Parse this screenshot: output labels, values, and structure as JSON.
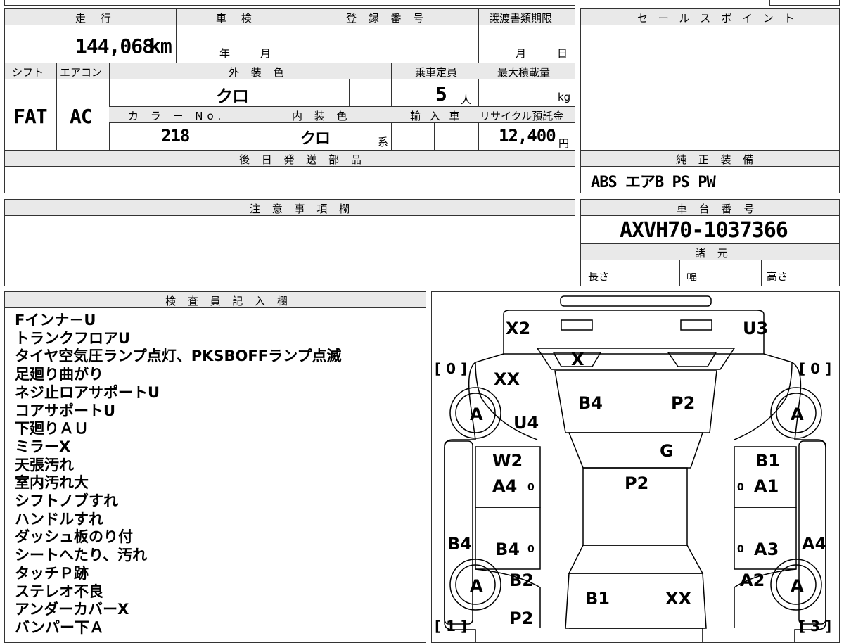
{
  "vehicle": {
    "mileage_label": "走 行",
    "mileage_value": "144,068",
    "mileage_unit": "km",
    "inspection_label": "車 検",
    "inspection_year": "年",
    "inspection_month": "月",
    "registration_label": "登 録 番 号",
    "transfer_deadline_label": "譲渡書類期限",
    "transfer_month": "月",
    "transfer_day": "日",
    "shift_label": "シフト",
    "shift_value": "FAT",
    "ac_label": "エアコン",
    "ac_value": "AC",
    "exterior_color_label": "外 装 色",
    "exterior_color_value": "クロ",
    "capacity_label": "乗車定員",
    "capacity_value": "5",
    "capacity_unit": "人",
    "max_load_label": "最大積載量",
    "max_load_unit": "kg",
    "color_no_label": "カ ラ ー No.",
    "color_no_value": "218",
    "interior_color_label": "内 装 色",
    "interior_color_value": "クロ",
    "interior_color_suffix": "系",
    "import_label": "輸 入 車",
    "recycle_label": "リサイクル預託金",
    "recycle_value": "12,400",
    "recycle_unit": "円",
    "later_parts_label": "後 日 発 送 部 品",
    "sales_point_label": "セ ー ル ス ポ イ ン ト",
    "equipment_label": "純 正 装 備",
    "equipment_value": "ABS エアB PS PW",
    "caution_label": "注 意 事 項 欄",
    "chassis_label": "車 台 番 号",
    "chassis_value": "AXVH70-1037366",
    "specs_label": "諸 元",
    "length_label": "長さ",
    "width_label": "幅",
    "height_label": "高さ"
  },
  "inspector": {
    "label": "検 査 員 記 入 欄",
    "notes": [
      "Fインナ－U",
      "トランクフロアU",
      "タイヤ空気圧ランプ点灯、PKSBOFFランプ点滅",
      "足廻り曲がり",
      "ネジ止ロアサポートU",
      "コアサポートU",
      "下廻りＡＵ",
      "ミラーX",
      "天張汚れ",
      "室内汚れ大",
      "シフトノブすれ",
      "ハンドルすれ",
      "ダッシュ板のり付",
      "シートへたり、汚れ",
      "タッチＰ跡",
      "ステレオ不良",
      "アンダーカバーX",
      "バンパー下Ａ"
    ]
  },
  "diagram": {
    "marks": {
      "rear_left": "X2",
      "rear_right": "U3",
      "rear_glass": "X",
      "tire_rl_bracket": "[ 0 ]",
      "tire_rr_bracket": "[ 0 ]",
      "trunk_left": "XX",
      "trunk_b4": "B4",
      "trunk_p2": "P2",
      "tire_rl": "A",
      "tire_rr": "A",
      "quarter_left": "U4",
      "roof_g": "G",
      "rear_door_left": "W2",
      "rear_door_right": "B1",
      "left_a4": "A4",
      "right_a1": "A1",
      "roof_p2": "P2",
      "sill_left": "B4",
      "sill_right": "A4",
      "front_door_left": "B4",
      "front_door_right": "A3",
      "fender_left": "B2",
      "fender_right": "A2",
      "tire_fl": "A",
      "tire_fr": "A",
      "hood_b1": "B1",
      "hood_xx": "XX",
      "bumper_p2": "P2",
      "tire_fl_bracket": "[ 1 ]",
      "tire_fr_bracket": "[ 3 ]",
      "zero": "0"
    }
  }
}
